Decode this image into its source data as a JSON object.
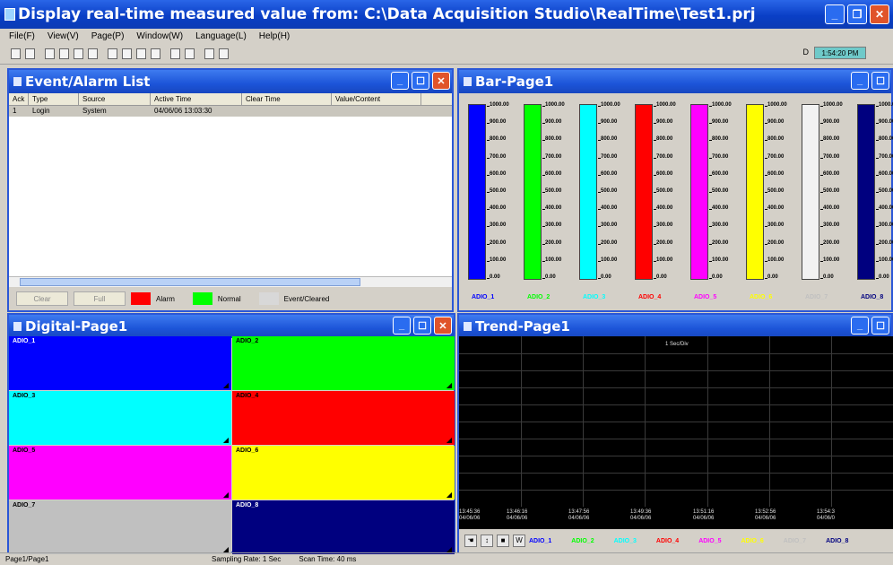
{
  "window": {
    "title": "Display real-time measured value from: C:\\Data Acquisition Studio\\RealTime\\Test1.prj"
  },
  "menu": [
    "File(F)",
    "View(V)",
    "Page(P)",
    "Window(W)",
    "Language(L)",
    "Help(H)"
  ],
  "toolbar": {
    "clock_label": "D",
    "clock": "1:54:20 PM"
  },
  "event_list": {
    "title": "Event/Alarm List",
    "columns": [
      "Ack",
      "Type",
      "Source",
      "Active Time",
      "Clear Time",
      "Value/Content"
    ],
    "rows": [
      [
        "1",
        "Login",
        "System",
        "04/06/06 13:03:30",
        "",
        ""
      ]
    ],
    "buttons": [
      "Clear",
      "Full"
    ],
    "legend": [
      {
        "label": "Alarm",
        "color": "#ff0000"
      },
      {
        "label": "Normal",
        "color": "#00ff00"
      },
      {
        "label": "Event/Cleared",
        "color": "#d8d8d8"
      }
    ]
  },
  "bar_page": {
    "title": "Bar-Page1",
    "scale": [
      "1000.00",
      "900.00",
      "800.00",
      "700.00",
      "600.00",
      "500.00",
      "400.00",
      "300.00",
      "200.00",
      "100.00",
      "0.00"
    ],
    "bars": [
      {
        "label": "ADIO_1",
        "color": "#0000ff",
        "value": 1.0
      },
      {
        "label": "ADIO_2",
        "color": "#00ff00",
        "value": 1.0
      },
      {
        "label": "ADIO_3",
        "color": "#00ffff",
        "value": 1.0
      },
      {
        "label": "ADIO_4",
        "color": "#ff0000",
        "value": 1.0
      },
      {
        "label": "ADIO_5",
        "color": "#ff00ff",
        "value": 1.0
      },
      {
        "label": "ADIO_6",
        "color": "#ffff00",
        "value": 1.0
      },
      {
        "label": "ADIO_7",
        "color": "#c0c0c0",
        "value": 0.0
      },
      {
        "label": "ADIO_8",
        "color": "#00007f",
        "value": 1.0
      }
    ]
  },
  "digital_page": {
    "title": "Digital-Page1",
    "cells": [
      {
        "label": "ADIO_1",
        "color": "#0000ff"
      },
      {
        "label": "ADIO_2",
        "color": "#00ff00"
      },
      {
        "label": "ADIO_3",
        "color": "#00ffff"
      },
      {
        "label": "ADIO_4",
        "color": "#ff0000"
      },
      {
        "label": "ADIO_5",
        "color": "#ff00ff"
      },
      {
        "label": "ADIO_6",
        "color": "#ffff00"
      },
      {
        "label": "ADIO_7",
        "color": "#c0c0c0"
      },
      {
        "label": "ADIO_8",
        "color": "#00007f"
      }
    ]
  },
  "trend_page": {
    "title": "Trend-Page1",
    "interval": "1 Sec/Div",
    "times": [
      {
        "time": "13:45:36",
        "date": "04/06/06"
      },
      {
        "time": "13:46:16",
        "date": "04/06/06"
      },
      {
        "time": "13:47:56",
        "date": "04/06/06"
      },
      {
        "time": "13:49:36",
        "date": "04/06/06"
      },
      {
        "time": "13:51:16",
        "date": "04/06/06"
      },
      {
        "time": "13:52:56",
        "date": "04/06/06"
      },
      {
        "time": "13:54:3",
        "date": "04/06/0"
      }
    ],
    "series": [
      {
        "label": "ADIO_1",
        "color": "#0000ff"
      },
      {
        "label": "ADIO_2",
        "color": "#00ff00"
      },
      {
        "label": "ADIO_3",
        "color": "#00ffff"
      },
      {
        "label": "ADIO_4",
        "color": "#ff0000"
      },
      {
        "label": "ADIO_5",
        "color": "#ff00ff"
      },
      {
        "label": "ADIO_6",
        "color": "#ffff00"
      },
      {
        "label": "ADIO_7",
        "color": "#c0c0c0"
      },
      {
        "label": "ADIO_8",
        "color": "#00007f"
      }
    ]
  },
  "status": {
    "page": "Page1/Page1",
    "sampling": "Sampling Rate: 1 Sec",
    "scan": "Scan Time: 40 ms"
  }
}
